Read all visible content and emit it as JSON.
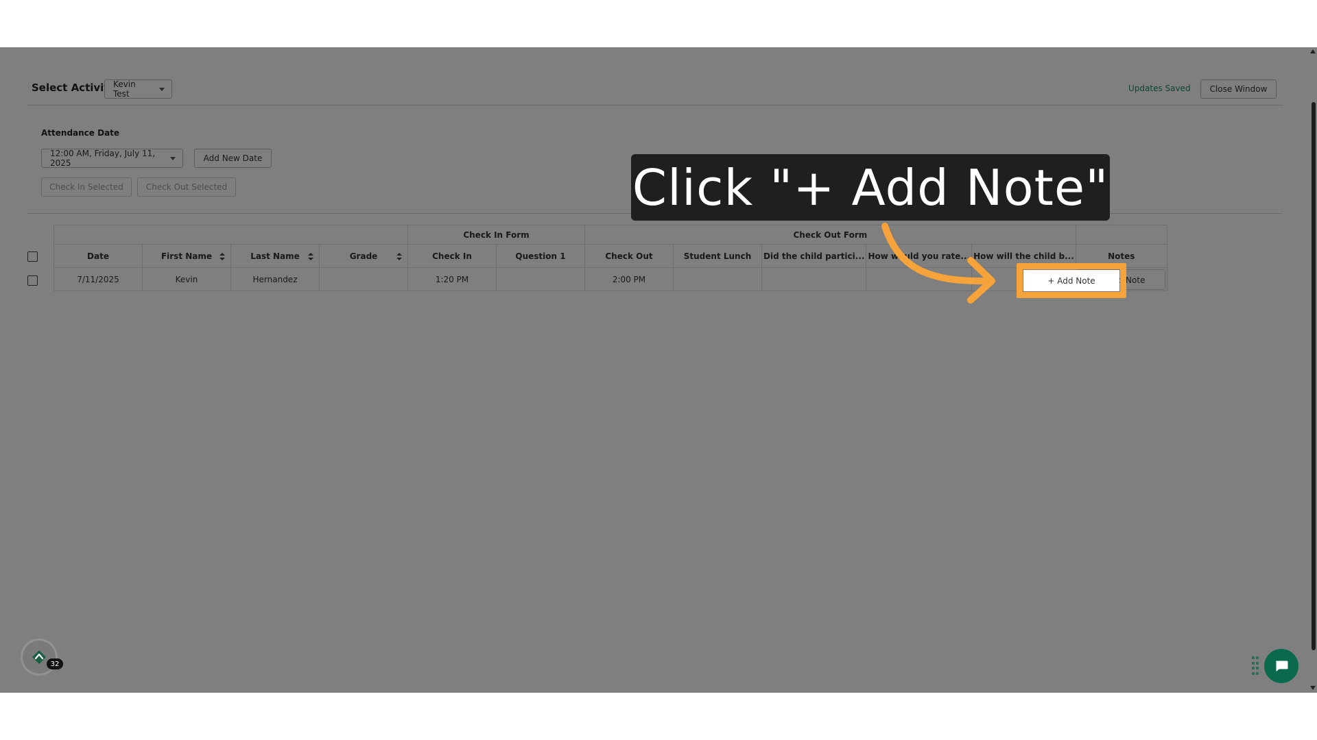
{
  "header": {
    "select_label": "Select Activity:",
    "activity_value": "Kevin Test",
    "status": "Updates Saved",
    "close_label": "Close Window"
  },
  "attendance": {
    "label": "Attendance Date",
    "date_value": "12:00 AM, Friday, July 11, 2025",
    "add_date_label": "Add New Date",
    "check_in_selected": "Check In Selected",
    "check_out_selected": "Check Out Selected"
  },
  "table": {
    "groups": {
      "check_in_form": "Check In Form",
      "check_out_form": "Check Out Form"
    },
    "columns": [
      "Date",
      "First Name",
      "Last Name",
      "Grade",
      "Check In",
      "Question 1",
      "Check Out",
      "Student Lunch",
      "Did the child partici...",
      "How would you rate...",
      "How will the child b...",
      "Notes"
    ],
    "rows": [
      {
        "date": "7/11/2025",
        "first_name": "Kevin",
        "last_name": "Hernandez",
        "grade": "",
        "check_in": "1:20 PM",
        "question_1": "",
        "check_out": "2:00 PM",
        "student_lunch": "",
        "q_participate": "",
        "q_rate": "",
        "q_behave": "",
        "notes_button": "+ Add Note"
      }
    ]
  },
  "overlay": {
    "callout": "Click \"+ Add Note\"",
    "highlight_label": "+ Add Note",
    "highlight_color": "#f5a33a"
  },
  "widgets": {
    "badge_count": "32"
  },
  "icons": {
    "logo": "brand-logo-icon",
    "chat": "chat-bubble-icon",
    "drag": "drag-handle-icon"
  }
}
